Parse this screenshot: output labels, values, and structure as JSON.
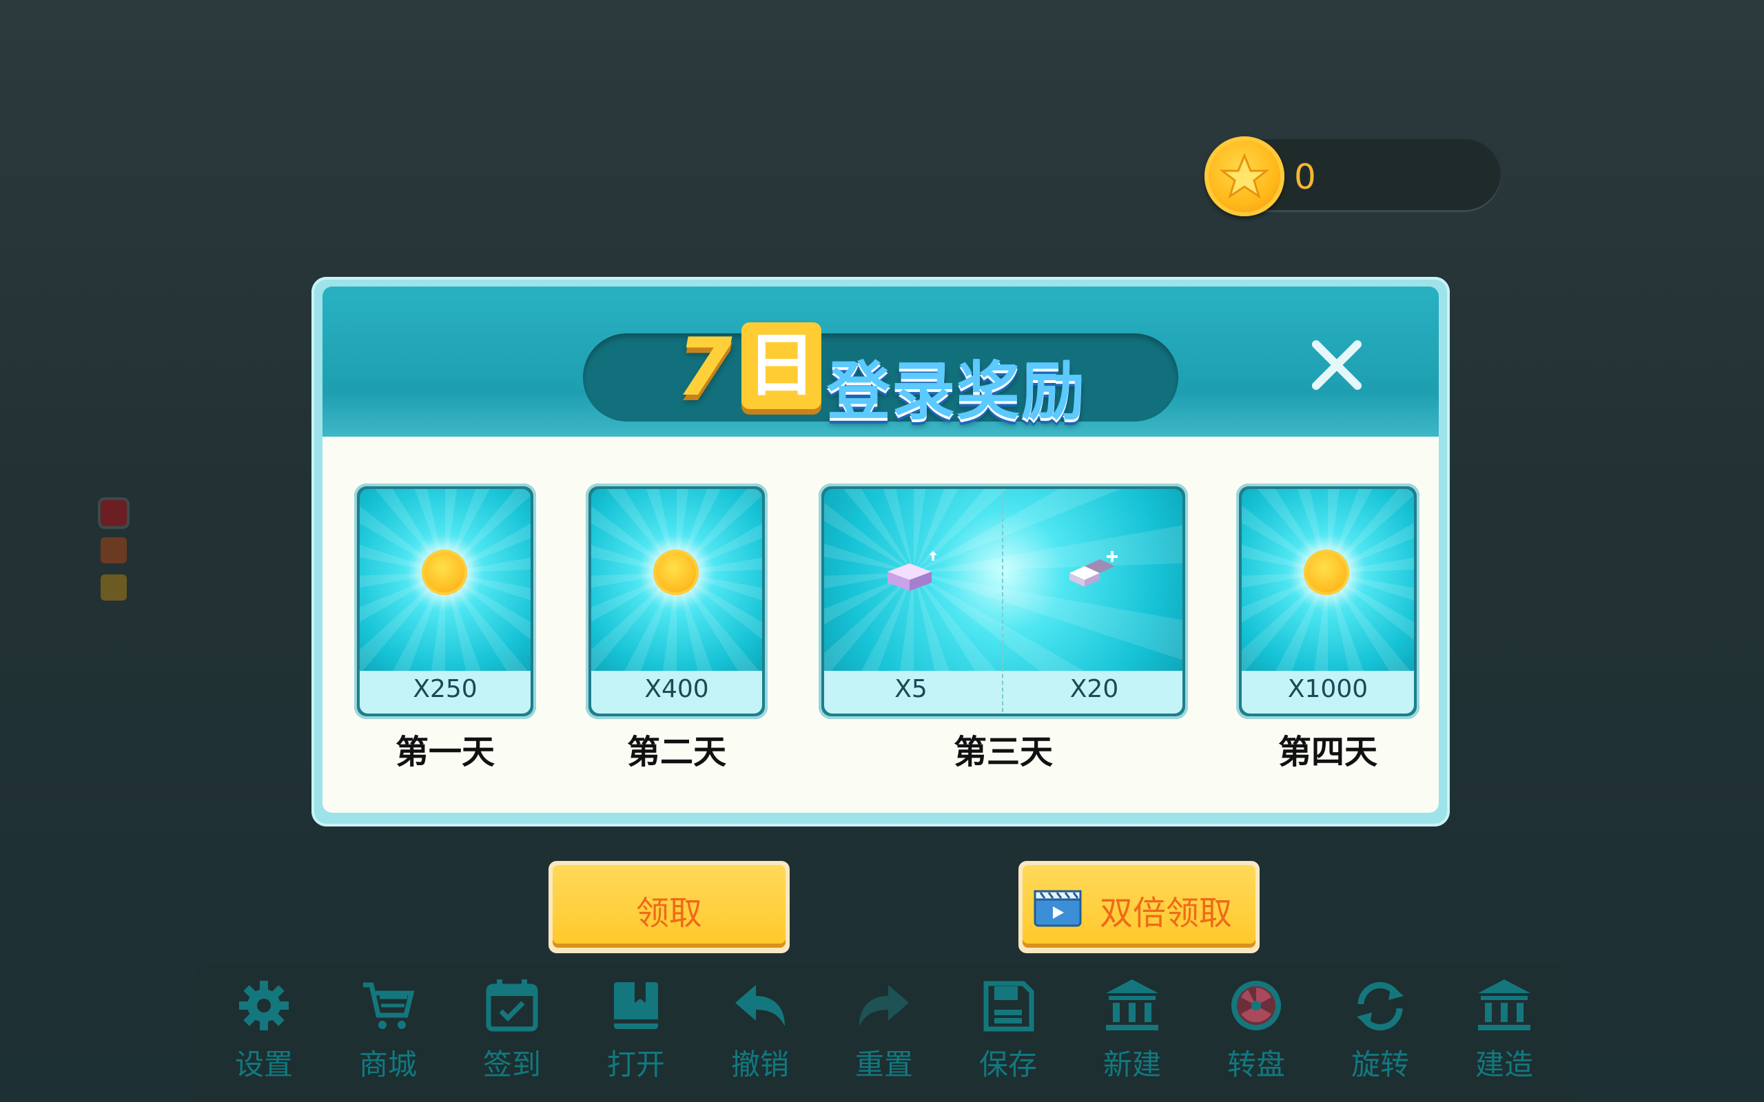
{
  "coins": {
    "count": "0"
  },
  "dialog": {
    "title_num": "7",
    "title_day": "日",
    "title_text": "登录奖励",
    "days": [
      {
        "label": "第一天",
        "rewards": [
          {
            "icon": "gold-coin-icon",
            "qty": "X250"
          }
        ]
      },
      {
        "label": "第二天",
        "rewards": [
          {
            "icon": "gold-coin-icon",
            "qty": "X400"
          }
        ]
      },
      {
        "label": "第三天",
        "rewards": [
          {
            "icon": "block-upgrade-icon",
            "qty": "X5"
          },
          {
            "icon": "block-add-icon",
            "qty": "X20"
          }
        ]
      },
      {
        "label": "第四天",
        "rewards": [
          {
            "icon": "gold-coin-icon",
            "qty": "X1000"
          }
        ]
      }
    ]
  },
  "buttons": {
    "claim": "领取",
    "double_claim": "双倍领取"
  },
  "toolbar": [
    {
      "label": "设置",
      "icon": "gear-icon"
    },
    {
      "label": "商城",
      "icon": "cart-icon"
    },
    {
      "label": "签到",
      "icon": "calendar-check-icon"
    },
    {
      "label": "打开",
      "icon": "book-icon"
    },
    {
      "label": "撤销",
      "icon": "undo-icon"
    },
    {
      "label": "重置",
      "icon": "redo-icon"
    },
    {
      "label": "保存",
      "icon": "save-icon"
    },
    {
      "label": "新建",
      "icon": "building-icon"
    },
    {
      "label": "转盘",
      "icon": "wheel-icon"
    },
    {
      "label": "旋转",
      "icon": "rotate-icon"
    },
    {
      "label": "建造",
      "icon": "building-icon"
    }
  ],
  "colors": {
    "accent": "#ffc92c",
    "button_text": "#ef6a19",
    "toolbar_text": "#11797f",
    "title_blue": "#5cc9ff"
  }
}
